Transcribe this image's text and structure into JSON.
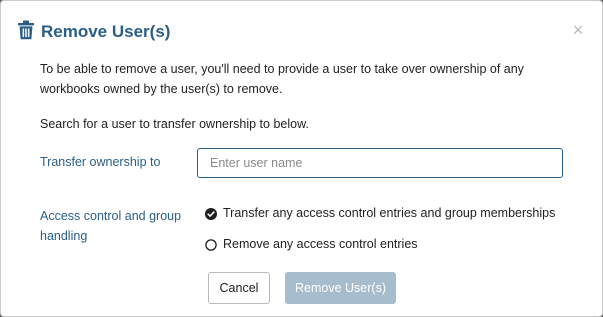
{
  "dialog": {
    "title": "Remove User(s)",
    "title_icon": "trash-icon",
    "close_icon": "close-icon",
    "close_glyph": "×",
    "intro_text": "To be able to remove a user, you'll need to provide a user to take over ownership of any workbooks owned by the user(s) to remove.",
    "search_hint": "Search for a user to transfer ownership to below."
  },
  "transfer": {
    "label": "Transfer ownership to",
    "placeholder": "Enter user name",
    "value": ""
  },
  "access": {
    "label": "Access control and group handling",
    "options": [
      {
        "label": "Transfer any access control entries and group memberships",
        "selected": true
      },
      {
        "label": "Remove any access control entries",
        "selected": false
      }
    ]
  },
  "buttons": {
    "cancel_label": "Cancel",
    "remove_label": "Remove User(s)",
    "remove_disabled": true
  },
  "colors": {
    "accent": "#2b5e86",
    "disabled_button": "#a7bccc",
    "close": "#b7b7b7"
  }
}
